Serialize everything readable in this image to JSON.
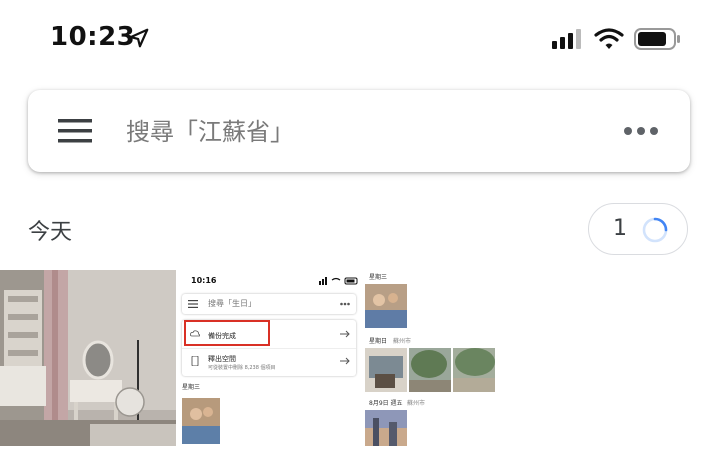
{
  "status_bar": {
    "time": "10:23",
    "icons": [
      "location-arrow-icon",
      "signal-icon",
      "wifi-icon",
      "battery-icon"
    ]
  },
  "search": {
    "placeholder": "搜尋「江蘇省」",
    "menu_icon": "hamburger-menu-icon",
    "more_icon": "more-horizontal-icon"
  },
  "section": {
    "title": "今天",
    "upload_count": "1"
  },
  "photos": [
    {
      "description_icon": "photo-thumbnail"
    },
    {
      "mini": {
        "time": "10:16",
        "search_text": "搜尋「生日」",
        "backup_label": "備份完成",
        "free_space_title": "釋出空間",
        "free_space_sub": "可從裝置中刪除 8,238 個項目",
        "day_label": "星期三"
      }
    },
    {
      "mini": {
        "label_1": "星期三",
        "label_2": "星期日",
        "label_2_loc": "蘇州市",
        "label_3": "8月9日 週五",
        "label_3_loc": "蘇州市"
      }
    }
  ],
  "colors": {
    "accent_blue": "#4285f4",
    "highlight_red": "#d93025",
    "text_primary": "#202124",
    "text_secondary": "#5f6368"
  }
}
